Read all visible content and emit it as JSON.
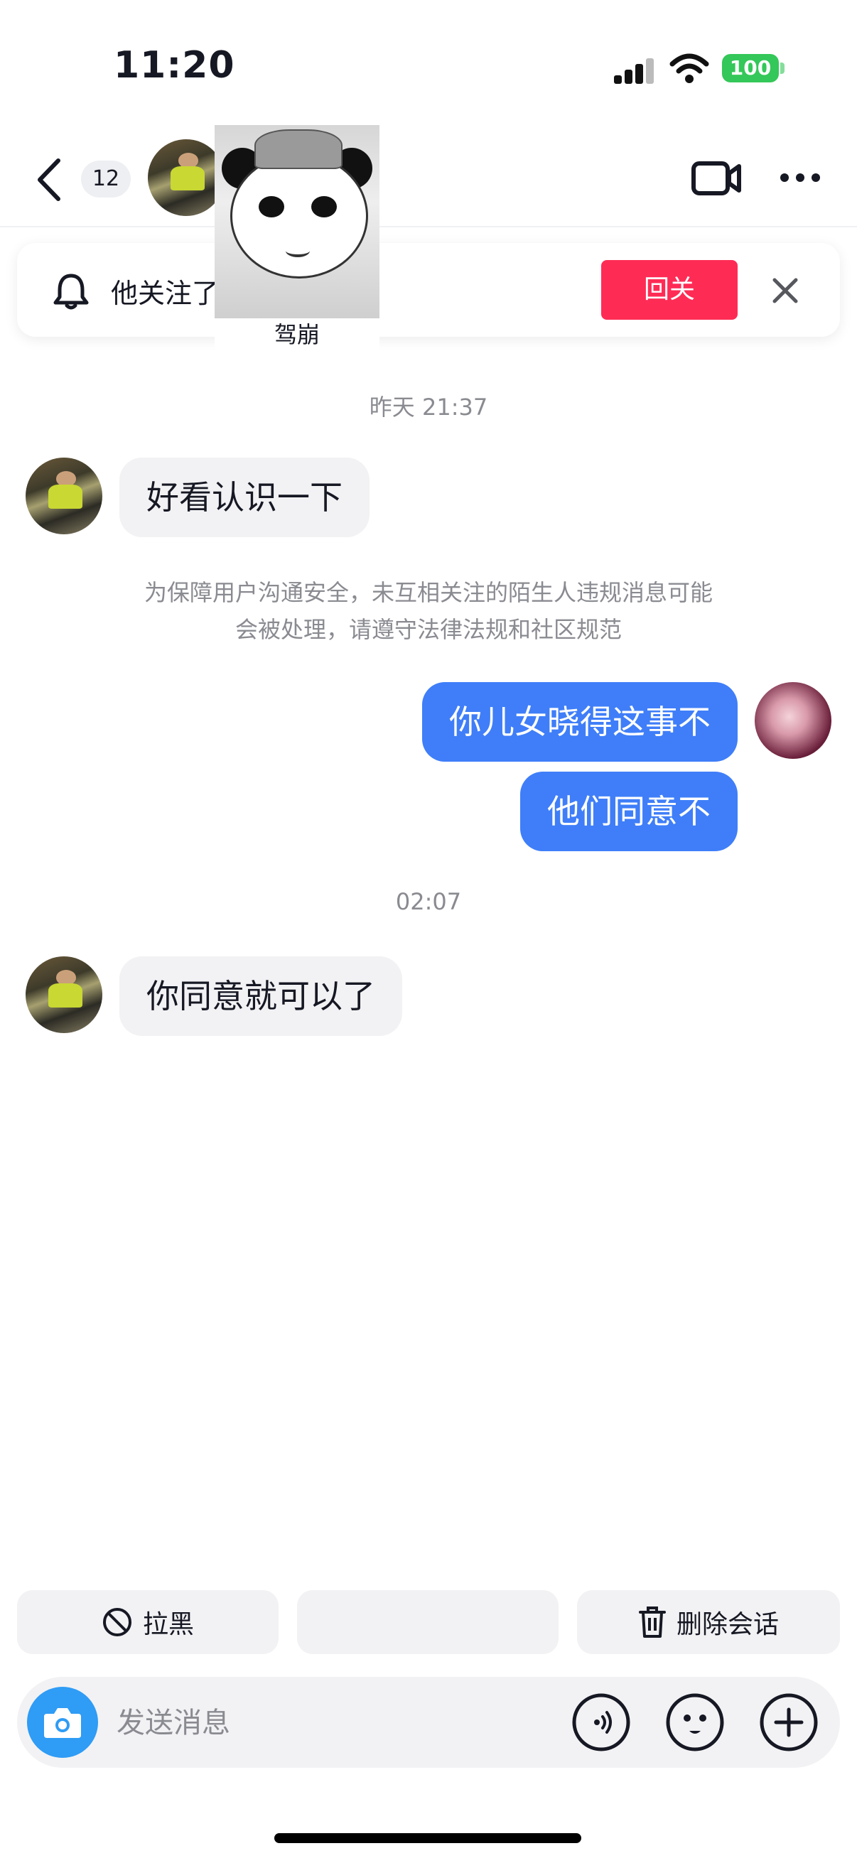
{
  "status_bar": {
    "time": "11:20",
    "battery": "100",
    "battery_color": "#34c759"
  },
  "header": {
    "unread_count": "12",
    "icons": [
      "chevron-left-icon",
      "video-call-icon",
      "more-icon"
    ]
  },
  "sticker": {
    "caption": "驾崩"
  },
  "follow_banner": {
    "text": "他关注了",
    "follow_back_label": "回关",
    "accent": "#fe2c55"
  },
  "chat": {
    "timestamps": [
      "昨天 21:37",
      "02:07"
    ],
    "messages": [
      {
        "side": "in",
        "text": "好看认识一下"
      },
      {
        "side": "out",
        "text": "你儿女晓得这事不"
      },
      {
        "side": "out",
        "text": "他们同意不"
      },
      {
        "side": "in",
        "text": "你同意就可以了"
      }
    ],
    "notice_line1": "为保障用户沟通安全，未互相关注的陌生人违规消息可能",
    "notice_line2": "会被处理，请遵守法律法规和社区规范",
    "outgoing_color": "#3f7ef8"
  },
  "actions": {
    "block_label": "拉黑",
    "delete_label": "删除会话"
  },
  "input": {
    "placeholder": "发送消息",
    "camera_color": "#2f9cf5"
  }
}
